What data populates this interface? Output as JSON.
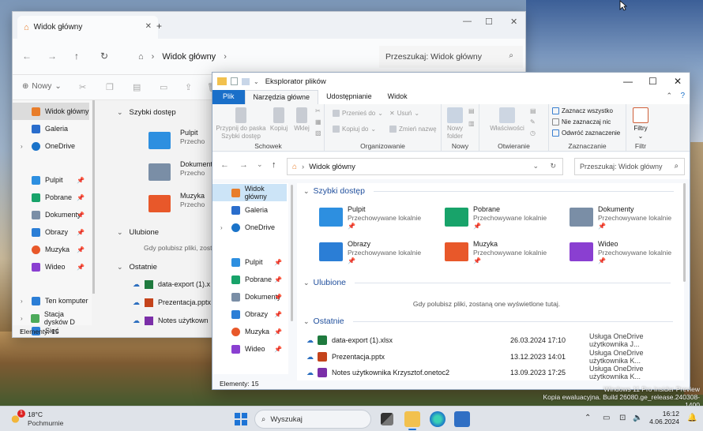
{
  "back_window": {
    "tab_title": "Widok główny",
    "address": "Widok główny",
    "search_placeholder": "Przeszukaj: Widok główny",
    "new_label": "Nowy",
    "sidebar": [
      {
        "label": "Widok główny",
        "icon": "home-icon",
        "color": "#e87d2a"
      },
      {
        "label": "Galeria",
        "icon": "gallery-icon",
        "color": "#2a6dcc"
      },
      {
        "label": "OneDrive",
        "icon": "cloud-icon",
        "color": "#1a73c9"
      },
      {
        "label": "Pulpit",
        "icon": "desktop-icon",
        "color": "#2d8fe0"
      },
      {
        "label": "Pobrane",
        "icon": "download-icon",
        "color": "#18a36a"
      },
      {
        "label": "Dokumenty",
        "icon": "documents-icon",
        "color": "#7a8ea6"
      },
      {
        "label": "Obrazy",
        "icon": "pictures-icon",
        "color": "#2b7ed6"
      },
      {
        "label": "Muzyka",
        "icon": "music-icon",
        "color": "#e8582a"
      },
      {
        "label": "Wideo",
        "icon": "video-icon",
        "color": "#8a3fd1"
      },
      {
        "label": "Ten komputer",
        "icon": "computer-icon",
        "color": "#2b7ed6"
      },
      {
        "label": "Stacja dysków D",
        "icon": "drive-icon",
        "color": "#4caa5a"
      },
      {
        "label": "Sieć",
        "icon": "network-icon",
        "color": "#2b7ed6"
      }
    ],
    "sections": {
      "quick_access": "Szybki dostęp",
      "favorites": "Ulubione",
      "recent": "Ostatnie"
    },
    "quick_items": [
      {
        "name": "Pulpit",
        "sub": "Przecho"
      },
      {
        "name": "Dokumenty",
        "sub": "Przecho"
      },
      {
        "name": "Muzyka",
        "sub": "Przecho"
      }
    ],
    "favorites_text": "Gdy polubisz pliki, zostaną",
    "recent_items": [
      "data-export (1).x",
      "Prezentacja.pptx",
      "Notes użytkown"
    ],
    "status": "Elementy: 15"
  },
  "front_window": {
    "title": "Eksplorator plików",
    "ribbon_tabs": [
      "Plik",
      "Narzędzia główne",
      "Udostępnianie",
      "Widok"
    ],
    "ribbon": {
      "pin_label": "Przypnij do paska Szybki dostęp",
      "copy": "Kopiuj",
      "paste": "Wklej",
      "clipboard_group": "Schowek",
      "move_to": "Przenieś do",
      "copy_to": "Kopiuj do",
      "delete": "Usuń",
      "rename": "Zmień nazwę",
      "organize_group": "Organizowanie",
      "new_folder": "Nowy folder",
      "new_group": "Nowy",
      "properties": "Właściwości",
      "open_group": "Otwieranie",
      "select_all": "Zaznacz wszystko",
      "select_none": "Nie zaznaczaj nic",
      "invert": "Odwróć zaznaczenie",
      "select_group": "Zaznaczanie",
      "filters": "Filtry",
      "filter_group": "Filtr"
    },
    "address": "Widok główny",
    "search_placeholder": "Przeszukaj: Widok główny",
    "sidebar": [
      {
        "label": "Widok główny",
        "color": "#e87d2a"
      },
      {
        "label": "Galeria",
        "color": "#2a6dcc"
      },
      {
        "label": "OneDrive",
        "color": "#1a73c9"
      },
      {
        "label": "Pulpit",
        "color": "#2d8fe0"
      },
      {
        "label": "Pobrane",
        "color": "#18a36a"
      },
      {
        "label": "Dokumenty",
        "color": "#7a8ea6"
      },
      {
        "label": "Obrazy",
        "color": "#2b7ed6"
      },
      {
        "label": "Muzyka",
        "color": "#e8582a"
      },
      {
        "label": "Wideo",
        "color": "#8a3fd1"
      }
    ],
    "sections": {
      "quick_access": "Szybki dostęp",
      "favorites": "Ulubione",
      "recent": "Ostatnie"
    },
    "quick_items": [
      {
        "name": "Pulpit",
        "sub": "Przechowywane lokalnie",
        "color": "#2d8fe0"
      },
      {
        "name": "Pobrane",
        "sub": "Przechowywane lokalnie",
        "color": "#18a36a"
      },
      {
        "name": "Dokumenty",
        "sub": "Przechowywane lokalnie",
        "color": "#7a8ea6"
      },
      {
        "name": "Obrazy",
        "sub": "Przechowywane lokalnie",
        "color": "#2b7ed6"
      },
      {
        "name": "Muzyka",
        "sub": "Przechowywane lokalnie",
        "color": "#e8582a"
      },
      {
        "name": "Wideo",
        "sub": "Przechowywane lokalnie",
        "color": "#8a3fd1"
      }
    ],
    "favorites_text": "Gdy polubisz pliki, zostaną one wyświetlone tutaj.",
    "recent_items": [
      {
        "name": "data-export (1).xlsx",
        "date": "26.03.2024 17:10",
        "location": "Usługa OneDrive użytkownika J...",
        "color": "#1f7a3e"
      },
      {
        "name": "Prezentacja.pptx",
        "date": "13.12.2023 14:01",
        "location": "Usługa OneDrive użytkownika K...",
        "color": "#c4431b"
      },
      {
        "name": "Notes użytkownika Krzysztof.onetoc2",
        "date": "13.09.2023 17:25",
        "location": "Usługa OneDrive użytkownika K...",
        "color": "#7b2fa8"
      }
    ],
    "status": "Elementy: 15"
  },
  "taskbar": {
    "temperature": "18°C",
    "weather": "Pochmurnie",
    "badge": "1",
    "search_placeholder": "Wyszukaj",
    "time": "16:12",
    "date": "4.06.2024"
  },
  "watermark": {
    "line1": "Windows 11 Pro Insider Preview",
    "line2": "Kopia ewaluacyjna. Build 26080.ge_release.240308-1400"
  }
}
